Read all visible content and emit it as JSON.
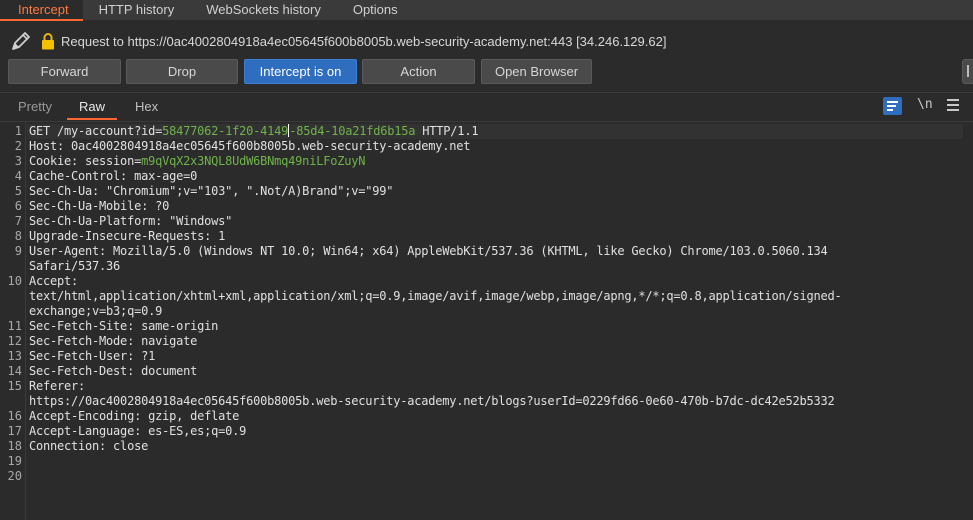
{
  "tabs": [
    {
      "label": "Intercept",
      "active": true
    },
    {
      "label": "HTTP history",
      "active": false
    },
    {
      "label": "WebSockets history",
      "active": false
    },
    {
      "label": "Options",
      "active": false
    }
  ],
  "request_info": "Request to https://0ac4002804918a4ec05645f600b8005b.web-security-academy.net:443  [34.246.129.62]",
  "buttons": {
    "forward": "Forward",
    "drop": "Drop",
    "intercept": "Intercept is on",
    "action": "Action",
    "open_browser": "Open Browser"
  },
  "view_tabs": {
    "pretty": "Pretty",
    "raw": "Raw",
    "hex": "Hex",
    "newline": "\\n"
  },
  "colors": {
    "accent": "#ff6633",
    "primary_button": "#2f6dbf",
    "param_value": "#6fb34a"
  },
  "icons": [
    "pencil-icon",
    "lock-icon",
    "wrap-lines-icon",
    "newline-icon",
    "menu-icon"
  ],
  "lines": {
    "l1": {
      "n": "1",
      "a": "GET /my-account?id=",
      "b": "58477062-1f20-4149",
      "c": "-85d4-10a21fd6b15a",
      "d": " HTTP/1.1"
    },
    "l2": {
      "n": "2",
      "t": "Host: 0ac4002804918a4ec05645f600b8005b.web-security-academy.net"
    },
    "l3": {
      "n": "3",
      "a": "Cookie: session=",
      "b": "m9qVqX2x3NQL8UdW6BNmq49niLFoZuyN"
    },
    "l4": {
      "n": "4",
      "t": "Cache-Control: max-age=0"
    },
    "l5": {
      "n": "5",
      "t": "Sec-Ch-Ua: \"Chromium\";v=\"103\", \".Not/A)Brand\";v=\"99\""
    },
    "l6": {
      "n": "6",
      "t": "Sec-Ch-Ua-Mobile: ?0"
    },
    "l7": {
      "n": "7",
      "t": "Sec-Ch-Ua-Platform: \"Windows\""
    },
    "l8": {
      "n": "8",
      "t": "Upgrade-Insecure-Requests: 1"
    },
    "l9": {
      "n": "9",
      "t": "User-Agent: Mozilla/5.0 (Windows NT 10.0; Win64; x64) AppleWebKit/537.36 (KHTML, like Gecko) Chrome/103.0.5060.134",
      "t2": "Safari/537.36"
    },
    "l10": {
      "n": "10",
      "t": "Accept:",
      "t2": "text/html,application/xhtml+xml,application/xml;q=0.9,image/avif,image/webp,image/apng,*/*;q=0.8,application/signed-",
      "t3": "exchange;v=b3;q=0.9"
    },
    "l11": {
      "n": "11",
      "t": "Sec-Fetch-Site: same-origin"
    },
    "l12": {
      "n": "12",
      "t": "Sec-Fetch-Mode: navigate"
    },
    "l13": {
      "n": "13",
      "t": "Sec-Fetch-User: ?1"
    },
    "l14": {
      "n": "14",
      "t": "Sec-Fetch-Dest: document"
    },
    "l15": {
      "n": "15",
      "t": "Referer:",
      "t2": "https://0ac4002804918a4ec05645f600b8005b.web-security-academy.net/blogs?userId=0229fd66-0e60-470b-b7dc-dc42e52b5332"
    },
    "l16": {
      "n": "16",
      "t": "Accept-Encoding: gzip, deflate"
    },
    "l17": {
      "n": "17",
      "t": "Accept-Language: es-ES,es;q=0.9"
    },
    "l18": {
      "n": "18",
      "t": "Connection: close"
    },
    "l19": {
      "n": "19"
    },
    "l20": {
      "n": "20"
    }
  }
}
